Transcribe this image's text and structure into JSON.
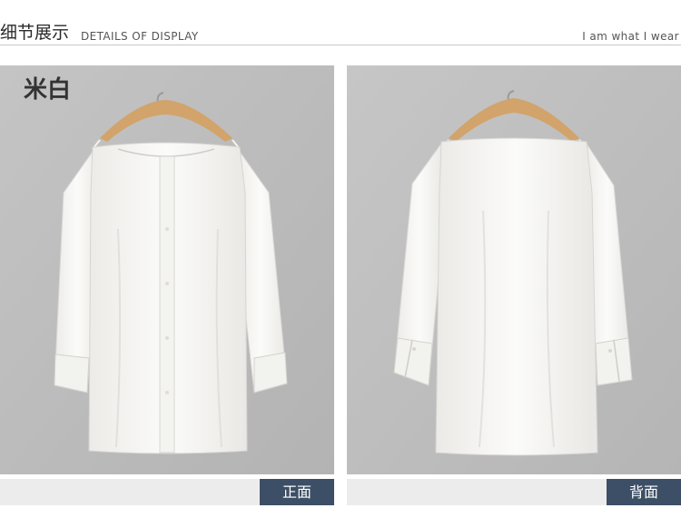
{
  "header": {
    "title_cn": "细节展示",
    "title_en": "DETAILS OF DISPLAY",
    "tagline": "I am what I wear"
  },
  "front_panel": {
    "color_label": "米白",
    "caption": "正面"
  },
  "back_panel": {
    "caption": "背面"
  },
  "colors": {
    "panel_background": "#bdbdbd",
    "caption_tag": "#3d4f66",
    "caption_bar": "#ececec",
    "garment": "#f7f7f5",
    "hanger": "#d2a36a"
  }
}
